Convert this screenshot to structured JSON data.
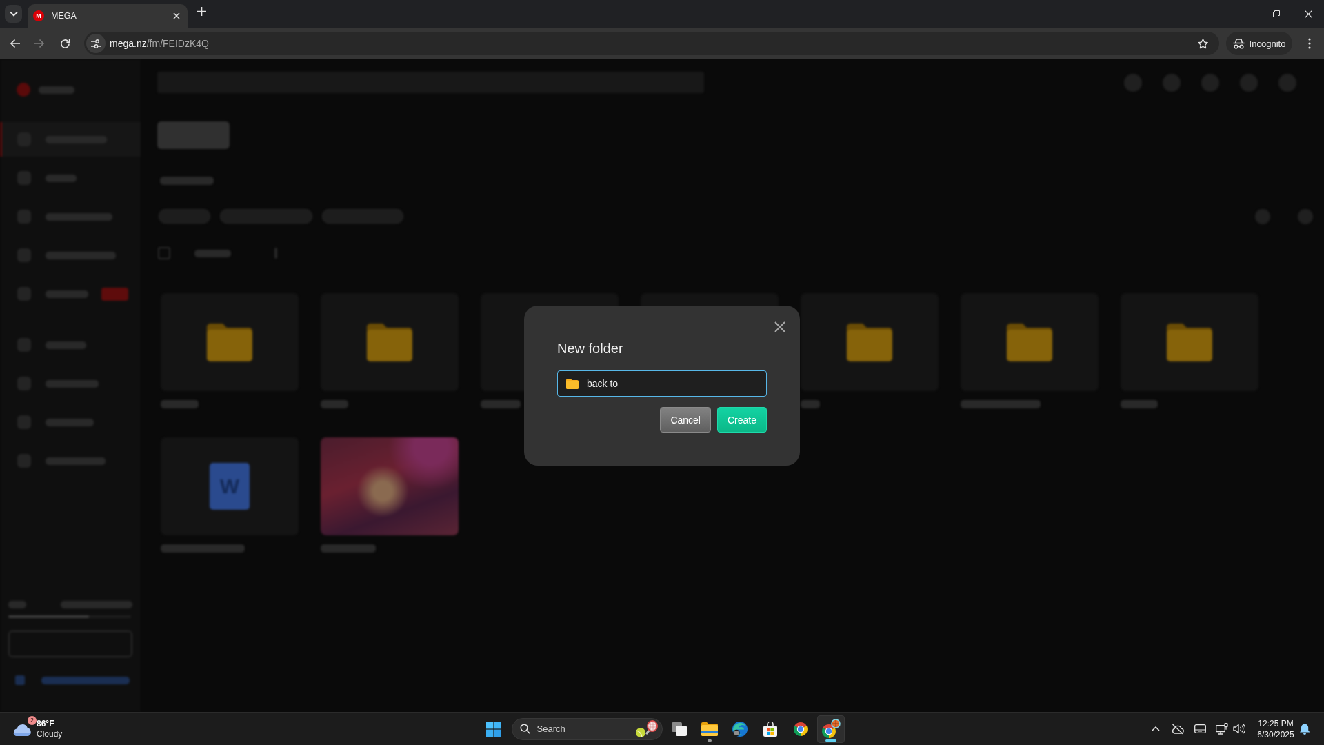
{
  "browser": {
    "tabs": [
      {
        "favicon_letter": "M",
        "title": "MEGA",
        "selected": true
      }
    ],
    "address": "mega.nz/fm/FEIDzK4Q",
    "profile_label": "Incognito"
  },
  "app": {
    "sidebar": {
      "groups": [
        {
          "items": [
            {
              "selected": true
            },
            {
              "selected": false
            },
            {
              "selected": false
            },
            {
              "selected": false
            },
            {
              "selected": false,
              "badge": true
            }
          ]
        },
        {
          "items": [
            {
              "selected": false
            },
            {
              "selected": false
            },
            {
              "selected": false
            },
            {
              "selected": false
            }
          ]
        }
      ]
    },
    "storage_bar": {
      "level": 0.66
    },
    "list_toolbar": {
      "checked": false
    },
    "tiles": [
      {
        "kind": "folder"
      },
      {
        "kind": "folder"
      },
      {
        "kind": "blank"
      },
      {
        "kind": "blank"
      },
      {
        "kind": "folder"
      },
      {
        "kind": "folder"
      },
      {
        "kind": "folder"
      },
      {
        "kind": "document",
        "icon_letter": "W"
      },
      {
        "kind": "photo"
      }
    ]
  },
  "dialog": {
    "title": "New folder",
    "field": {
      "value": "back to ",
      "focused": true
    },
    "buttons": [
      {
        "label": "Cancel",
        "kind": "secondary"
      },
      {
        "label": "Create",
        "kind": "primary"
      }
    ]
  },
  "taskbar": {
    "weather": {
      "badge": "2",
      "temperature": "86°F",
      "condition": "Cloudy"
    },
    "search": {
      "placeholder": "Search"
    },
    "apps": [
      {
        "kind": "task-view",
        "running": false,
        "selected": false
      },
      {
        "kind": "file-explorer",
        "running": true,
        "selected": false
      },
      {
        "kind": "edge",
        "running": false,
        "selected": false
      },
      {
        "kind": "store",
        "running": false,
        "selected": false
      },
      {
        "kind": "chrome",
        "running": false,
        "selected": false
      },
      {
        "kind": "chrome-incognito",
        "running": true,
        "selected": true
      }
    ],
    "clock": {
      "time": "12:25 PM",
      "date": "6/30/2025"
    }
  }
}
